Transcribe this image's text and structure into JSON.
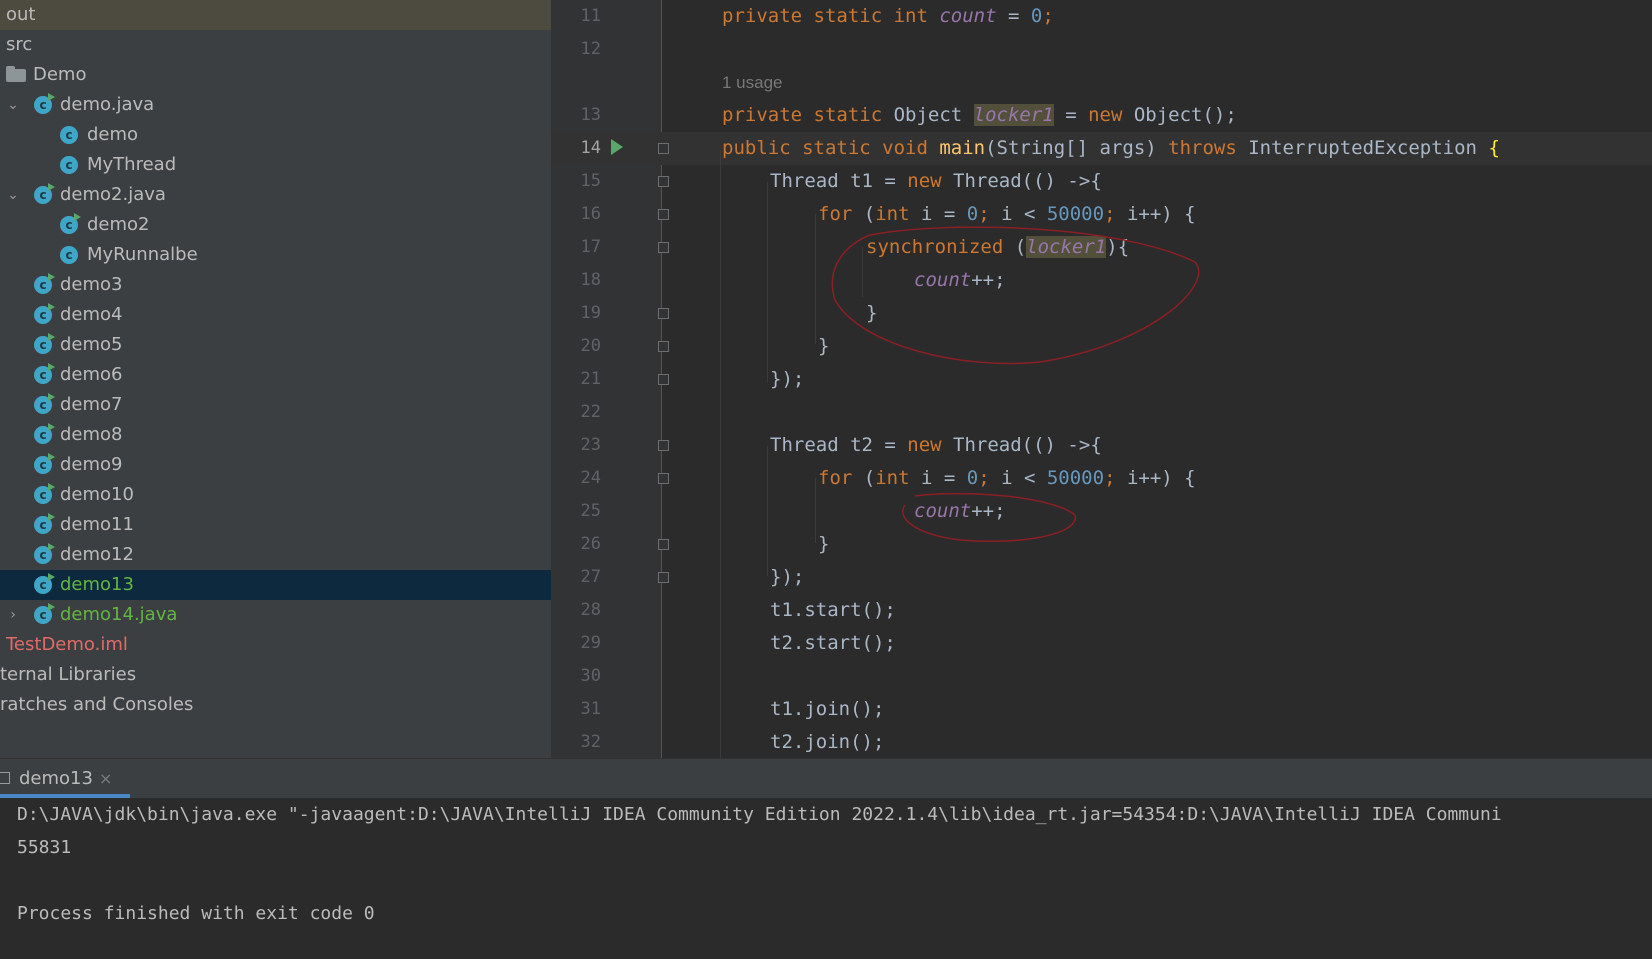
{
  "project_tree": {
    "items": [
      {
        "label": "out"
      },
      {
        "label": "src"
      },
      {
        "label": "Demo"
      },
      {
        "label": "demo.java"
      },
      {
        "label": "demo"
      },
      {
        "label": "MyThread"
      },
      {
        "label": "demo2.java"
      },
      {
        "label": "demo2"
      },
      {
        "label": "MyRunnalbe"
      },
      {
        "label": "demo3"
      },
      {
        "label": "demo4"
      },
      {
        "label": "demo5"
      },
      {
        "label": "demo6"
      },
      {
        "label": "demo7"
      },
      {
        "label": "demo8"
      },
      {
        "label": "demo9"
      },
      {
        "label": "demo10"
      },
      {
        "label": "demo11"
      },
      {
        "label": "demo12"
      },
      {
        "label": "demo13"
      },
      {
        "label": "demo14.java"
      },
      {
        "label": "TestDemo.iml"
      },
      {
        "label": "ternal Libraries"
      },
      {
        "label": "ratches and Consoles"
      }
    ]
  },
  "editor": {
    "line_numbers": [
      "11",
      "12",
      "13",
      "14",
      "15",
      "16",
      "17",
      "18",
      "19",
      "20",
      "21",
      "22",
      "23",
      "24",
      "25",
      "26",
      "27",
      "28",
      "29",
      "30",
      "31",
      "32"
    ],
    "usage_hint": "1 usage",
    "code": {
      "l11": {
        "a": "private static int ",
        "b": "count",
        "c": " = ",
        "d": "0",
        "e": ";"
      },
      "l13": {
        "a": "private static ",
        "b": "Object ",
        "c": "locker1",
        "d": " = ",
        "e": "new ",
        "f": "Object();"
      },
      "l14": {
        "a": "public static void ",
        "b": "main",
        "c": "(String[] args) ",
        "d": "throws ",
        "e": "InterruptedException ",
        "f": "{"
      },
      "l15": {
        "a": "Thread t1 = ",
        "b": "new ",
        "c": "Thread(() ->{"
      },
      "l16": {
        "a": "for ",
        "b": "(",
        "c": "int ",
        "d": "i = ",
        "e": "0",
        "f": "; ",
        "g": "i < ",
        "h": "50000",
        "i": "; ",
        "j": "i++) {"
      },
      "l17": {
        "a": "synchronized ",
        "b": "(",
        "c": "locker1",
        "d": "){"
      },
      "l18": {
        "a": "count",
        "b": "++;"
      },
      "l19": "}",
      "l20": "}",
      "l21": {
        "a": "});"
      },
      "l23": {
        "a": "Thread t2 = ",
        "b": "new ",
        "c": "Thread(() ->{"
      },
      "l24": {
        "a": "for ",
        "b": "(",
        "c": "int ",
        "d": "i = ",
        "e": "0",
        "f": "; ",
        "g": "i < ",
        "h": "50000",
        "i": "; ",
        "j": "i++) {"
      },
      "l25": {
        "a": "count",
        "b": "++;"
      },
      "l26": "}",
      "l27": {
        "a": "});"
      },
      "l28": {
        "a": "t1.start();"
      },
      "l29": {
        "a": "t2.start();"
      },
      "l31": {
        "a": "t1.join();"
      },
      "l32": {
        "a": "t2.join();"
      }
    }
  },
  "run_panel": {
    "tab_label": "demo13",
    "close_symbol": "×",
    "console_lines": [
      "D:\\JAVA\\jdk\\bin\\java.exe \"-javaagent:D:\\JAVA\\IntelliJ IDEA Community Edition 2022.1.4\\lib\\idea_rt.jar=54354:D:\\JAVA\\IntelliJ IDEA Communi",
      "55831",
      "",
      "Process finished with exit code 0"
    ]
  },
  "colors": {
    "annotation_stroke": "#8a1f24",
    "keyword": "#cc7832",
    "number": "#6897bb",
    "field": "#9876aa",
    "method": "#ffc66d"
  }
}
